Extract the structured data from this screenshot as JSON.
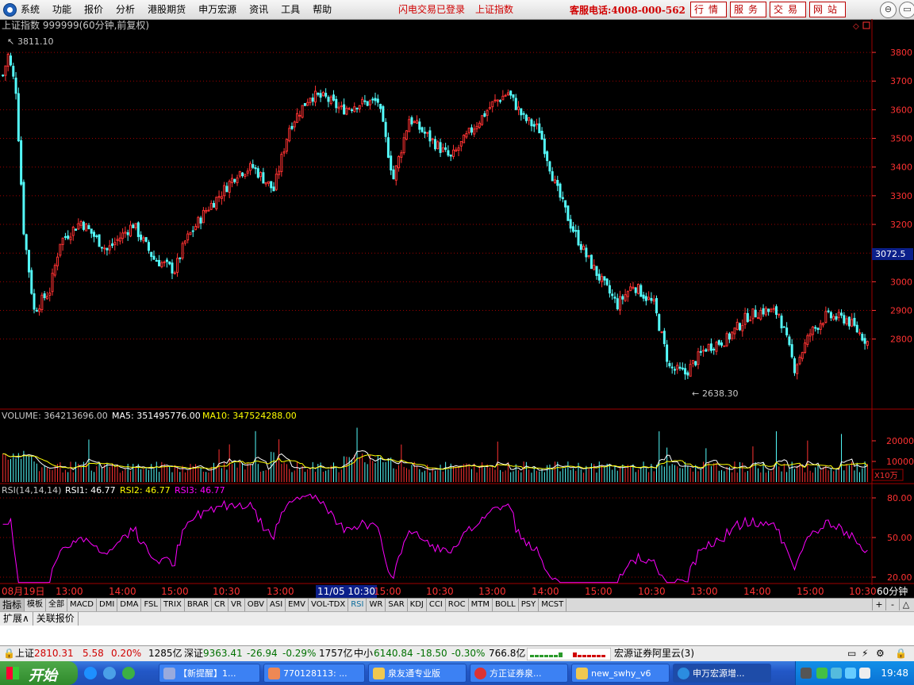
{
  "menu": {
    "items": [
      "系统",
      "功能",
      "报价",
      "分析",
      "港股期货",
      "申万宏源",
      "资讯",
      "工具",
      "帮助"
    ],
    "login_status": "闪电交易已登录",
    "index_link": "上证指数",
    "hotline": "客服电话:4008-000-562",
    "nav_buttons": [
      "行情",
      "服务",
      "交易",
      "网站"
    ],
    "window_controls": [
      "⊖",
      "▭",
      "✕"
    ]
  },
  "chart": {
    "title": "上证指数 999999(60分钟,前复权)",
    "high_label": "3811.10",
    "low_label": "2638.30",
    "current_price_tag": "3072.5",
    "price_axis": [
      "3800",
      "3700",
      "3600",
      "3500",
      "3400",
      "3300",
      "3200",
      "3100",
      "3000",
      "2900",
      "2800"
    ],
    "volume": {
      "label": "VOLUME: 364213696.00",
      "ma5": "MA5: 351495776.00",
      "ma10": "MA10: 347524288.00",
      "axis": [
        "20000",
        "10000"
      ],
      "unit": "X10万"
    },
    "rsi": {
      "label": "RSI(14,14,14)",
      "rsi1": "RSI1: 46.77",
      "rsi2": "RSI2: 46.77",
      "rsi3": "RSI3: 46.77",
      "axis": [
        "80.00",
        "50.00",
        "20.00"
      ]
    },
    "time_axis": [
      "08月19日",
      "13:00",
      "14:00",
      "15:00",
      "10:30",
      "13:00",
      "11/05 10:30",
      "15:00",
      "10:30",
      "13:00",
      "14:00",
      "15:00",
      "10:30",
      "13:00",
      "14:00",
      "15:00",
      "10:30"
    ],
    "period": "60分钟",
    "colors": {
      "up": "#ff3232",
      "down": "#54fcfc",
      "rsi": "#ff00ff",
      "ma5": "#ffffff",
      "ma10": "#ffff00",
      "grid": "#a00000"
    }
  },
  "chart_data": {
    "type": "candlestick",
    "title": "上证指数 999999(60分钟,前复权)",
    "x_axis_labels": [
      "08月19日",
      "13:00",
      "14:00",
      "15:00",
      "10:30",
      "13:00",
      "11/05 10:30",
      "15:00",
      "10:30",
      "13:00",
      "14:00",
      "15:00",
      "10:30",
      "13:00",
      "14:00",
      "15:00",
      "10:30"
    ],
    "y_range": [
      2600,
      3850
    ],
    "highest": 3811.1,
    "lowest": 2638.3,
    "close_path": [
      [
        0,
        3720
      ],
      [
        2,
        3790
      ],
      [
        5,
        3670
      ],
      [
        8,
        3180
      ],
      [
        12,
        2900
      ],
      [
        18,
        2970
      ],
      [
        22,
        3140
      ],
      [
        30,
        3210
      ],
      [
        40,
        3110
      ],
      [
        50,
        3200
      ],
      [
        58,
        3080
      ],
      [
        66,
        3040
      ],
      [
        70,
        3140
      ],
      [
        78,
        3250
      ],
      [
        84,
        3310
      ],
      [
        90,
        3380
      ],
      [
        96,
        3400
      ],
      [
        104,
        3320
      ],
      [
        110,
        3540
      ],
      [
        118,
        3650
      ],
      [
        124,
        3640
      ],
      [
        130,
        3600
      ],
      [
        136,
        3620
      ],
      [
        144,
        3630
      ],
      [
        150,
        3360
      ],
      [
        156,
        3570
      ],
      [
        164,
        3500
      ],
      [
        172,
        3430
      ],
      [
        180,
        3530
      ],
      [
        188,
        3620
      ],
      [
        194,
        3660
      ],
      [
        200,
        3570
      ],
      [
        206,
        3530
      ],
      [
        212,
        3340
      ],
      [
        218,
        3200
      ],
      [
        224,
        3090
      ],
      [
        230,
        3000
      ],
      [
        236,
        2920
      ],
      [
        242,
        2990
      ],
      [
        250,
        2920
      ],
      [
        256,
        2700
      ],
      [
        262,
        2680
      ],
      [
        270,
        2770
      ],
      [
        278,
        2800
      ],
      [
        286,
        2880
      ],
      [
        292,
        2900
      ],
      [
        298,
        2890
      ],
      [
        304,
        2700
      ],
      [
        310,
        2820
      ],
      [
        316,
        2880
      ],
      [
        324,
        2870
      ],
      [
        332,
        2790
      ]
    ],
    "volume": {
      "label": "VOLUME",
      "value": 364213696.0,
      "ma5": 351495776.0,
      "ma10": 347524288.0,
      "axis": [
        10000,
        20000
      ],
      "unit": "X10万"
    },
    "rsi": {
      "params": "14,14,14",
      "rsi1": 46.77,
      "rsi2": 46.77,
      "rsi3": 46.77,
      "axis": [
        20,
        50,
        80
      ]
    }
  },
  "indicator_tabs": [
    "指标",
    "模板",
    "全部",
    "MACD",
    "DMI",
    "DMA",
    "FSL",
    "TRIX",
    "BRAR",
    "CR",
    "VR",
    "OBV",
    "ASI",
    "EMV",
    "VOL-TDX",
    "RSI",
    "WR",
    "SAR",
    "KDJ",
    "CCI",
    "ROC",
    "MTM",
    "BOLL",
    "PSY",
    "MCST"
  ],
  "tab_controls": [
    "+",
    "-",
    "△"
  ],
  "extra_tabs": [
    "扩展∧",
    "关联报价"
  ],
  "status": {
    "sh_name": "上证",
    "sh_value": "2810.31",
    "sh_change": "5.58",
    "sh_pct": "0.20%",
    "sh_amount": "1285亿",
    "sz_name": "深证",
    "sz_value": "9363.41",
    "sz_change": "-26.94",
    "sz_pct": "-0.29%",
    "sz_amount": "1757亿",
    "sme_name": "中小",
    "sme_value": "6140.84",
    "sme_change": "-18.50",
    "sme_pct": "-0.30%",
    "sme_amount": "766.8亿",
    "broker": "宏源证券阿里云(3)"
  },
  "taskbar": {
    "start": "开始",
    "tasks": [
      "【新提醒】1...",
      "770128113: ...",
      "泉友通专业版",
      "方正证券泉...",
      "new_swhy_v6",
      "申万宏源增..."
    ],
    "clock": "19:48"
  }
}
